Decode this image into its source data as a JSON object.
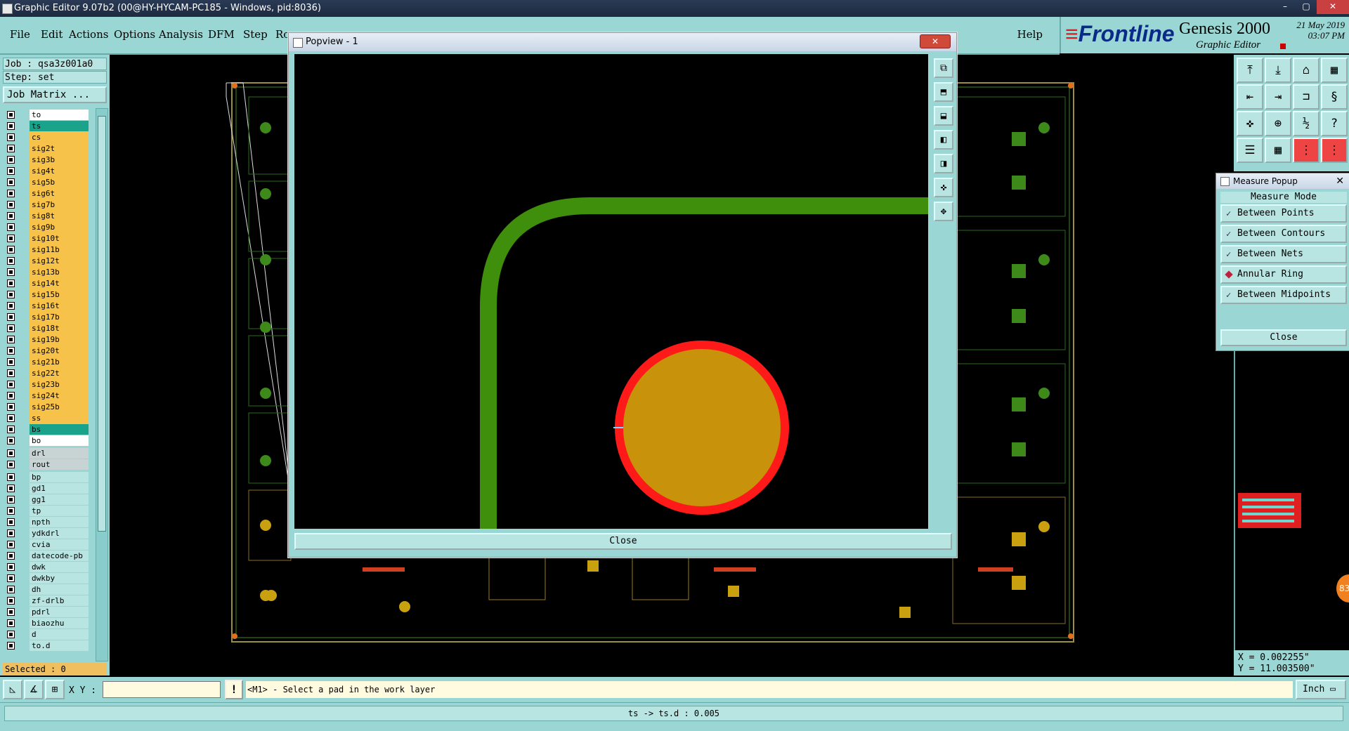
{
  "window": {
    "title": "Graphic Editor 9.07b2 (00@HY-HYCAM-PC185 - Windows, pid:8036)"
  },
  "menu": {
    "items": [
      "File",
      "Edit",
      "Actions",
      "Options",
      "Analysis",
      "DFM",
      "Step",
      "Ro"
    ],
    "help": "Help"
  },
  "brand": {
    "logo": "Frontline",
    "product": "Genesis 2000",
    "subtitle": "Graphic Editor",
    "date": "21 May 2019",
    "time": "03:07 PM"
  },
  "left": {
    "job": "Job : qsa3z001a0",
    "step": "Step: set",
    "job_matrix": "Job Matrix ...",
    "selected": "Selected : 0",
    "layers": [
      {
        "name": "to",
        "color": "#ffffff"
      },
      {
        "name": "ts",
        "color": "#1aa28a"
      },
      {
        "name": "cs",
        "color": "#f6c24a"
      },
      {
        "name": "sig2t",
        "color": "#f6c24a"
      },
      {
        "name": "sig3b",
        "color": "#f6c24a"
      },
      {
        "name": "sig4t",
        "color": "#f6c24a"
      },
      {
        "name": "sig5b",
        "color": "#f6c24a"
      },
      {
        "name": "sig6t",
        "color": "#f6c24a"
      },
      {
        "name": "sig7b",
        "color": "#f6c24a"
      },
      {
        "name": "sig8t",
        "color": "#f6c24a"
      },
      {
        "name": "sig9b",
        "color": "#f6c24a"
      },
      {
        "name": "sig10t",
        "color": "#f6c24a"
      },
      {
        "name": "sig11b",
        "color": "#f6c24a"
      },
      {
        "name": "sig12t",
        "color": "#f6c24a"
      },
      {
        "name": "sig13b",
        "color": "#f6c24a"
      },
      {
        "name": "sig14t",
        "color": "#f6c24a"
      },
      {
        "name": "sig15b",
        "color": "#f6c24a"
      },
      {
        "name": "sig16t",
        "color": "#f6c24a"
      },
      {
        "name": "sig17b",
        "color": "#f6c24a"
      },
      {
        "name": "sig18t",
        "color": "#f6c24a"
      },
      {
        "name": "sig19b",
        "color": "#f6c24a"
      },
      {
        "name": "sig20t",
        "color": "#f6c24a"
      },
      {
        "name": "sig21b",
        "color": "#f6c24a"
      },
      {
        "name": "sig22t",
        "color": "#f6c24a"
      },
      {
        "name": "sig23b",
        "color": "#f6c24a"
      },
      {
        "name": "sig24t",
        "color": "#f6c24a"
      },
      {
        "name": "sig25b",
        "color": "#f6c24a"
      },
      {
        "name": "ss",
        "color": "#f6c24a"
      },
      {
        "name": "bs",
        "color": "#1aa28a"
      },
      {
        "name": "bo",
        "color": "#ffffff"
      },
      {
        "name": "drl",
        "color": "#c8d4d4"
      },
      {
        "name": "rout",
        "color": "#c8d4d4"
      },
      {
        "name": "bp",
        "color": "#b8e4e2"
      },
      {
        "name": "gd1",
        "color": "#b8e4e2"
      },
      {
        "name": "gg1",
        "color": "#b8e4e2"
      },
      {
        "name": "tp",
        "color": "#b8e4e2"
      },
      {
        "name": "npth",
        "color": "#b8e4e2"
      },
      {
        "name": "ydkdrl",
        "color": "#b8e4e2"
      },
      {
        "name": "cvia",
        "color": "#b8e4e2"
      },
      {
        "name": "datecode-pb",
        "color": "#b8e4e2"
      },
      {
        "name": "dwk",
        "color": "#b8e4e2"
      },
      {
        "name": "dwkby",
        "color": "#b8e4e2"
      },
      {
        "name": "dh",
        "color": "#b8e4e2"
      },
      {
        "name": "zf-drlb",
        "color": "#b8e4e2"
      },
      {
        "name": "pdrl",
        "color": "#b8e4e2"
      },
      {
        "name": "biaozhu",
        "color": "#b8e4e2"
      },
      {
        "name": "d",
        "color": "#b8e4e2"
      },
      {
        "name": "to.d",
        "color": "#b8e4e2"
      }
    ]
  },
  "popview": {
    "title": "Popview - 1",
    "close": "Close"
  },
  "measure": {
    "title": "Measure Popup",
    "mode": "Measure Mode",
    "options": [
      "Between Points",
      "Between Contours",
      "Between Nets",
      "Annular Ring",
      "Between Midpoints"
    ],
    "selected": "Annular Ring",
    "close": "Close"
  },
  "coords": {
    "x": "X = 0.002255\"",
    "y": "Y = 11.003500\""
  },
  "bottom": {
    "xy_label": "X Y :",
    "xy_value": "",
    "prompt": "<M1> - Select a pad in the work layer",
    "units": "Inch"
  },
  "status": "ts -> ts.d : 0.005",
  "badge": "83"
}
